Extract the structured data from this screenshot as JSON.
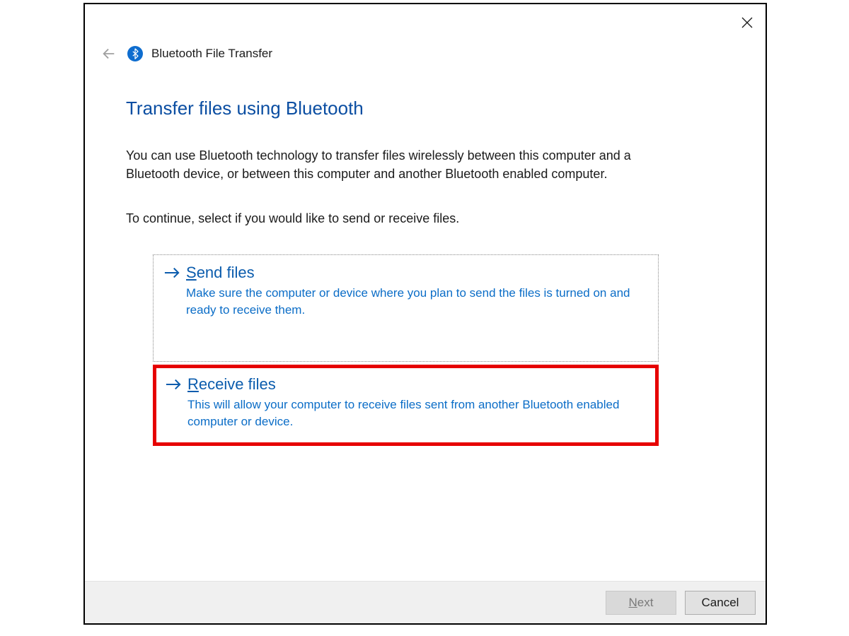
{
  "window": {
    "title": "Bluetooth File Transfer"
  },
  "content": {
    "headline": "Transfer files using Bluetooth",
    "description": "You can use Bluetooth technology to transfer files wirelessly between this computer and a Bluetooth device, or between this computer and another Bluetooth enabled computer.",
    "instruction": "To continue, select if you would like to send or receive files."
  },
  "options": {
    "send": {
      "title_mn": "S",
      "title_rest": "end files",
      "subtitle": "Make sure the computer or device where you plan to send the files is turned on and ready to receive them."
    },
    "receive": {
      "title_mn": "R",
      "title_rest": "eceive files",
      "subtitle": "This will allow your computer to receive files sent from another Bluetooth enabled computer or device."
    }
  },
  "footer": {
    "next_mn": "N",
    "next_rest": "ext",
    "cancel": "Cancel"
  }
}
